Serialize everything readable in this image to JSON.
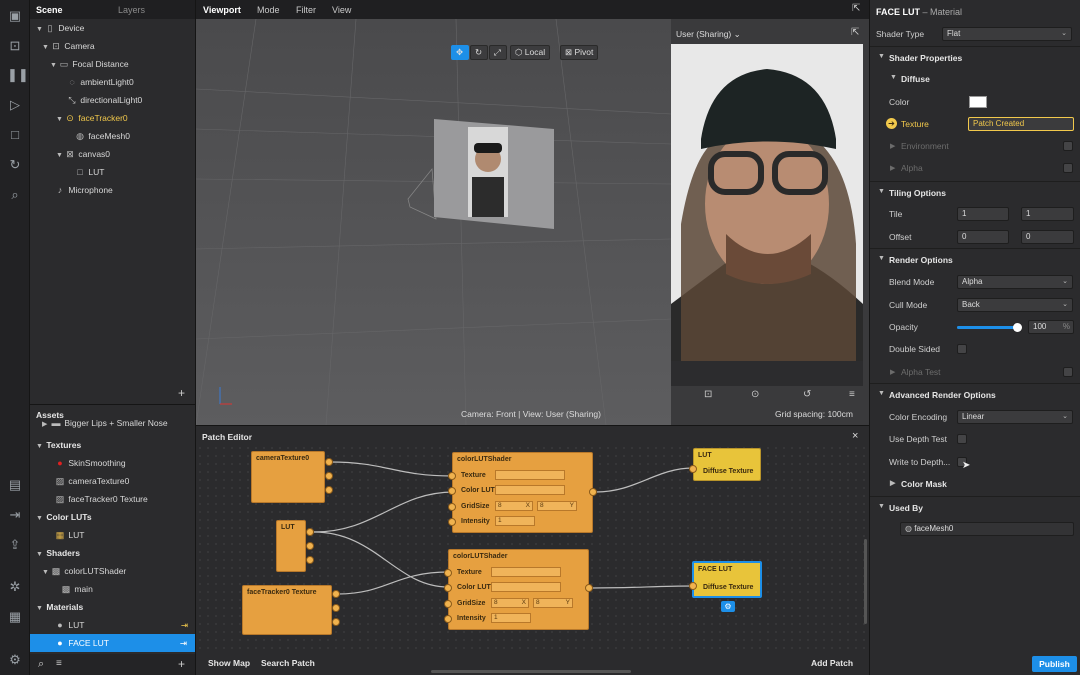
{
  "colors": {
    "accent": "#1d8fe8",
    "patch_node": "#e6a040",
    "output_node": "#e8c43a",
    "highlight": "#f2c94c"
  },
  "iconbar": [
    "layout-icon",
    "video-icon",
    "pause-icon",
    "play-icon",
    "square-icon",
    "refresh-icon",
    "search-icon",
    "folder-icon",
    "export-icon",
    "upload-icon",
    "bug-icon",
    "grid-icon",
    "settings-icon"
  ],
  "scene": {
    "tab_scene": "Scene",
    "tab_layers": "Layers",
    "tree": [
      "Device",
      "Camera",
      "Focal Distance",
      "ambientLight0",
      "directionalLight0",
      "faceTracker0",
      "faceMesh0",
      "canvas0",
      "LUT",
      "Microphone"
    ],
    "add_label": "+"
  },
  "assets": {
    "title": "Assets",
    "clipped_item": "Bigger Lips + Smaller Nose",
    "textures_header": "Textures",
    "textures": [
      "SkinSmoothing",
      "cameraTexture0",
      "faceTracker0 Texture"
    ],
    "color_luts_header": "Color LUTs",
    "color_luts": [
      "LUT"
    ],
    "shaders_header": "Shaders",
    "shaders": [
      "colorLUTShader",
      "main"
    ],
    "materials_header": "Materials",
    "materials": [
      "LUT",
      "FACE LUT"
    ],
    "add_label": "+"
  },
  "viewport": {
    "title": "Viewport",
    "menus": [
      "Mode",
      "Filter",
      "View"
    ],
    "local_label": "Local",
    "pivot_label": "Pivot",
    "status": "Camera: Front | View: User (Sharing)",
    "grid": "Grid spacing: 100cm",
    "preview_selector": "User (Sharing)"
  },
  "patch_editor": {
    "title": "Patch Editor",
    "close": "×",
    "nodes": {
      "cameraTexture": "cameraTexture0",
      "lut": "LUT",
      "faceTrackerTexture": "faceTracker0 Texture",
      "shader1": "colorLUTShader",
      "shader2": "colorLUTShader",
      "out1": "LUT",
      "out2": "FACE LUT"
    },
    "ports": {
      "texture": "Texture",
      "color_lut": "Color LUT",
      "grid_size": "GridSize",
      "intensity": "Intensity",
      "diffuse_texture": "Diffuse Texture"
    },
    "values": {
      "grid_x": "8",
      "grid_y": "8",
      "axis_x": "X",
      "axis_y": "Y",
      "intensity": "1"
    },
    "footer": {
      "show_map": "Show Map",
      "search_patch": "Search Patch",
      "add_patch": "Add Patch"
    }
  },
  "properties": {
    "title": "FACE LUT",
    "subtitle": "– Material",
    "shader_type_label": "Shader Type",
    "shader_type_value": "Flat",
    "shader_properties": "Shader Properties",
    "diffuse": "Diffuse",
    "color_label": "Color",
    "texture_label": "Texture",
    "texture_value": "Patch Created",
    "environment": "Environment",
    "alpha": "Alpha",
    "tiling_options": "Tiling Options",
    "tile_label": "Tile",
    "tile_x": "1",
    "tile_y": "1",
    "offset_label": "Offset",
    "offset_x": "0",
    "offset_y": "0",
    "render_options": "Render Options",
    "blend_mode_label": "Blend Mode",
    "blend_mode_value": "Alpha",
    "cull_mode_label": "Cull Mode",
    "cull_mode_value": "Back",
    "opacity_label": "Opacity",
    "opacity_value": "100",
    "opacity_unit": "%",
    "opacity_level": 1.0,
    "double_sided_label": "Double Sided",
    "alpha_test": "Alpha Test",
    "advanced_render_options": "Advanced Render Options",
    "color_encoding_label": "Color Encoding",
    "color_encoding_value": "Linear",
    "use_depth_test_label": "Use Depth Test",
    "write_to_depth_label": "Write to Depth...",
    "color_mask": "Color Mask",
    "used_by": "Used By",
    "used_by_item": "faceMesh0",
    "publish": "Publish"
  }
}
